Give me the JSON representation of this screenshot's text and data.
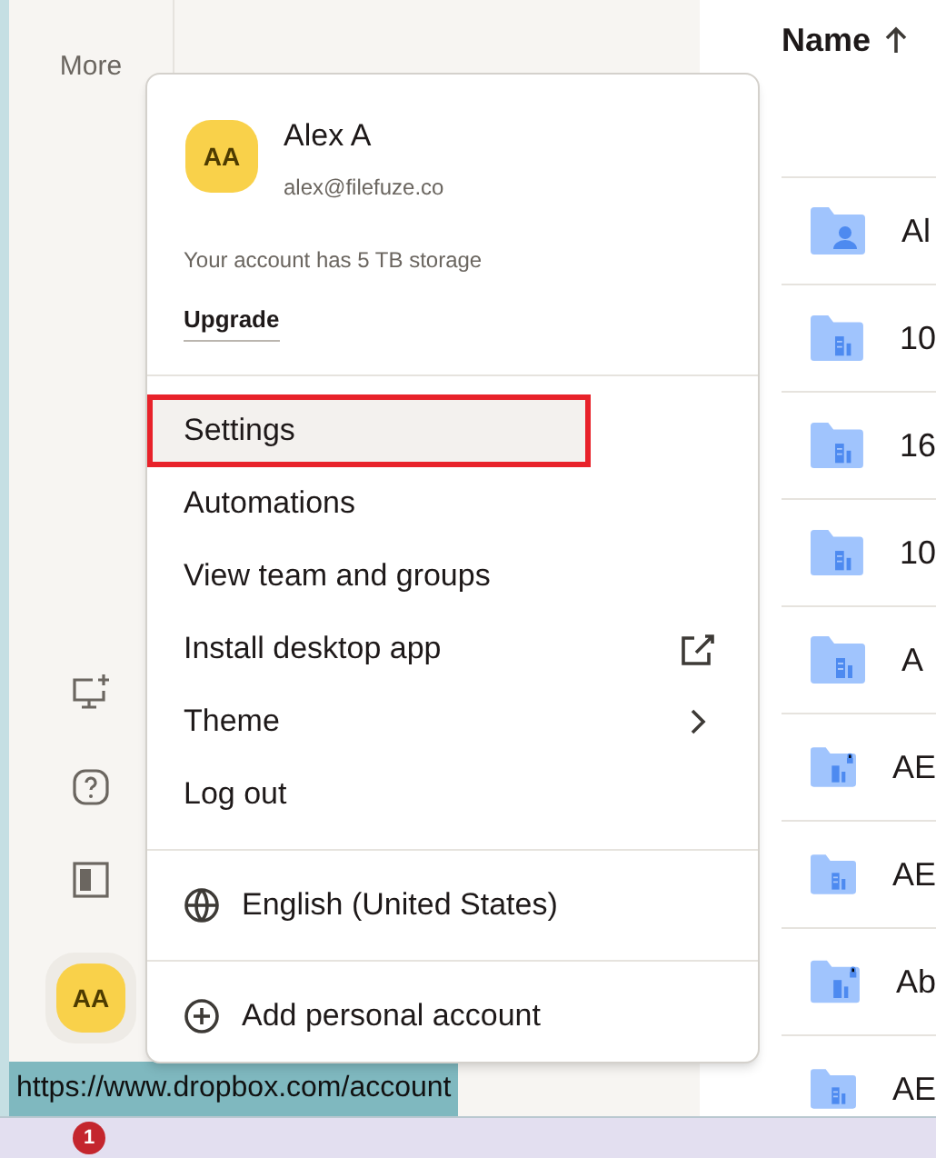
{
  "rail": {
    "more_label": "More"
  },
  "file_list": {
    "header": "Name",
    "rows": [
      {
        "name": "Al",
        "kind": "shared"
      },
      {
        "name": "10",
        "kind": "team"
      },
      {
        "name": "16",
        "kind": "team"
      },
      {
        "name": "10",
        "kind": "team"
      },
      {
        "name": "A",
        "kind": "team"
      },
      {
        "name": "AE",
        "kind": "locked"
      },
      {
        "name": "AE",
        "kind": "team"
      },
      {
        "name": "Ab",
        "kind": "locked"
      },
      {
        "name": "AE",
        "kind": "team"
      }
    ]
  },
  "account_menu": {
    "initials": "AA",
    "name": "Alex A",
    "email": "alex@filefuze.co",
    "storage_note": "Your account has 5 TB storage",
    "upgrade": "Upgrade",
    "items": [
      {
        "label": "Settings",
        "selected": true,
        "kind": "plain"
      },
      {
        "label": "Automations",
        "selected": false,
        "kind": "plain"
      },
      {
        "label": "View team and groups",
        "selected": false,
        "kind": "plain"
      },
      {
        "label": "Install desktop app",
        "selected": false,
        "kind": "external"
      },
      {
        "label": "Theme",
        "selected": false,
        "kind": "submenu"
      },
      {
        "label": "Log out",
        "selected": false,
        "kind": "plain"
      }
    ],
    "language": "English (United States)",
    "add_account": "Add personal account"
  },
  "rail_avatar": "AA",
  "status_url": "https://www.dropbox.com/account",
  "taskbar": {
    "notification_count": "1"
  }
}
